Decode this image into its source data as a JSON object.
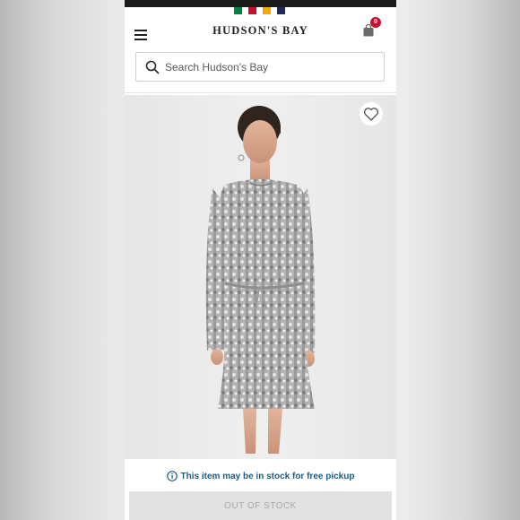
{
  "header": {
    "brand": "HUDSON'S BAY",
    "cart_count": "0",
    "stripe_colors": [
      "#00843d",
      "#c8102e",
      "#f2a900",
      "#1f2a58"
    ]
  },
  "search": {
    "placeholder": "Search Hudson's Bay"
  },
  "product": {
    "favorite_icon": "heart-outline-icon"
  },
  "availability": {
    "info_icon": "info-circle-icon",
    "message": "This item may be in stock for free pickup",
    "button_label": "OUT OF STOCK"
  },
  "colors": {
    "accent_text": "#1f5d82",
    "badge": "#c8102e",
    "disabled_button": "#e2e2e2"
  }
}
